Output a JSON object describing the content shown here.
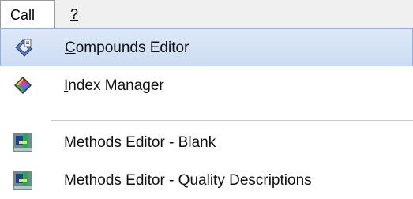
{
  "menubar": {
    "call": {
      "first": "C",
      "rest": "all"
    },
    "help": {
      "label": "?"
    }
  },
  "menu": {
    "items": [
      {
        "first": "C",
        "rest": "ompounds Editor",
        "icon": "compounds-editor-icon",
        "highlighted": true
      },
      {
        "first": "I",
        "rest": "ndex Manager",
        "icon": "index-manager-icon"
      },
      {
        "pre": "",
        "first": "M",
        "rest": "ethods Editor - Blank",
        "icon": "methods-editor-icon"
      },
      {
        "pre": "M",
        "first": "e",
        "rest": "thods Editor - Quality Descriptions",
        "icon": "methods-editor-icon"
      }
    ]
  },
  "colors": {
    "highlight": "#cddcf3",
    "highlight_border": "#8fb0e4",
    "menubar_bg": "#f0f0f0"
  }
}
